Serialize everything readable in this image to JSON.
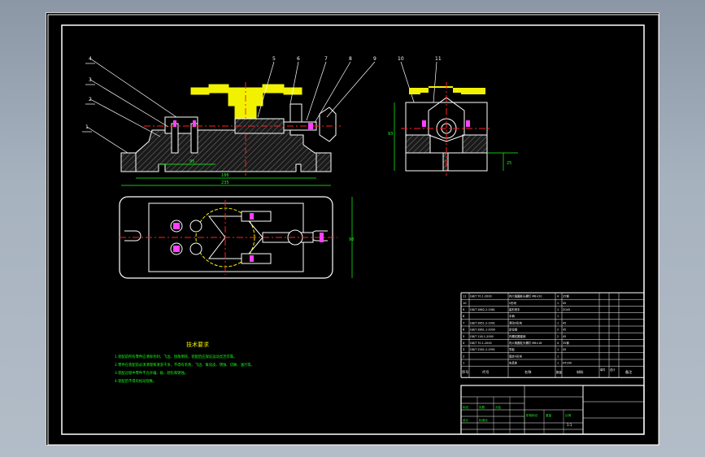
{
  "drawing": {
    "balloons": [
      "4",
      "3",
      "2",
      "1",
      "5",
      "6",
      "7",
      "8",
      "9",
      "10",
      "11"
    ],
    "dimensions": {
      "front_inner": "95",
      "front_mid": "186",
      "front_overall": "235",
      "top_width": "98",
      "side_height": "93",
      "side_small": "25"
    },
    "tech_requirements": {
      "title": "技术要求",
      "lines": [
        "1.装配前所有零件应清除毛刺、飞边、锐角倒钝，装配后应保证运动灵活可靠。",
        "2.零件在装配前必须清理和清洗干净，不得有毛刺、飞边、氧化皮、锈蚀、切屑、油污等。",
        "3.装配过程中零件不允许磕、碰、划伤和锈蚀。",
        "4.装配后不得有松动现象。"
      ]
    },
    "bom": {
      "rows": [
        {
          "no": "11",
          "code": "GB/T 70.1-2000",
          "name": "内六角圆柱头螺钉 M8×20",
          "qty": "4",
          "material": "35钢",
          "note": ""
        },
        {
          "no": "10",
          "code": "",
          "name": "V形块",
          "qty": "1",
          "material": "45",
          "note": ""
        },
        {
          "no": "9",
          "code": "GB/T 2862.2-1981",
          "name": "星形把手",
          "qty": "1",
          "material": "ZG45",
          "note": ""
        },
        {
          "no": "8",
          "code": "",
          "name": "手柄",
          "qty": "1",
          "material": "",
          "note": ""
        },
        {
          "no": "7",
          "code": "GB/T 2851.2-1991",
          "name": "滑动V形块",
          "qty": "1",
          "material": "45",
          "note": ""
        },
        {
          "no": "6",
          "code": "GB/T 2861.1-2000",
          "name": "定位销",
          "qty": "2",
          "material": "45",
          "note": ""
        },
        {
          "no": "5",
          "code": "GB/T 118.1-2000",
          "name": "内螺纹圆锥销",
          "qty": "2",
          "material": "45",
          "note": ""
        },
        {
          "no": "4",
          "code": "GB/T 70.1-2000",
          "name": "内六角圆柱头螺钉 M6×16",
          "qty": "4",
          "material": "35钢",
          "note": ""
        },
        {
          "no": "3",
          "code": "GB/T 2281.2-1991",
          "name": "导板",
          "qty": "1",
          "material": "45",
          "note": ""
        },
        {
          "no": "2",
          "code": "",
          "name": "固定V形块",
          "qty": "1",
          "material": "",
          "note": ""
        },
        {
          "no": "1",
          "code": "",
          "name": "夹具体",
          "qty": "1",
          "material": "HT200",
          "note": ""
        }
      ],
      "header": {
        "no": "序号",
        "code": "代号",
        "name": "名称",
        "qty": "数量",
        "material": "材料",
        "unit_weight": "单件",
        "total_weight": "总计",
        "note": "备注"
      }
    },
    "title_block": {
      "labels": [
        "标记",
        "处数",
        "分区",
        "更改文件号",
        "签名",
        "年月日",
        "设计",
        "标准化",
        "阶段标记",
        "重量",
        "比例"
      ],
      "scale": "1:1"
    }
  },
  "colors": {
    "frame": "#ffffff",
    "yellow": "#f2f200",
    "green": "#19ff19",
    "red": "#ff2020",
    "magenta": "#ff40ff",
    "hatch": "#3a3a3a"
  }
}
